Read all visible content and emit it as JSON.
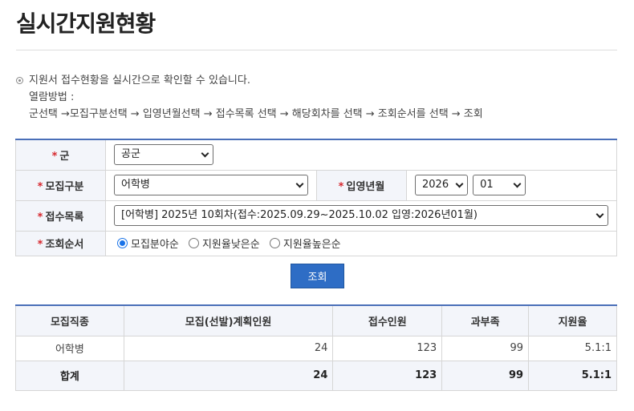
{
  "page": {
    "title": "실시간지원현황"
  },
  "notice": {
    "line1": "지원서 접수현황을 실시간으로 확인할 수 있습니다.",
    "line2": "열람방법 :",
    "line3": "군선택 →모집구분선택 → 입영년월선택 → 접수목록 선택 → 해당회차를 선택 → 조회순서를 선택 → 조회"
  },
  "form": {
    "required_mark": "*",
    "branch": {
      "label": "군",
      "value": "공군"
    },
    "recruit_type": {
      "label": "모집구분",
      "value": "어학병"
    },
    "enlist_month": {
      "label": "입영년월",
      "year": "2026",
      "month": "01"
    },
    "application_list": {
      "label": "접수목록",
      "value": "[어학병] 2025년 10회차(접수:2025.09.29~2025.10.02 입영:2026년01월)"
    },
    "sort_order": {
      "label": "조회순서",
      "options": [
        "모집분야순",
        "지원율낮은순",
        "지원율높은순"
      ],
      "selected": "모집분야순"
    }
  },
  "search_button": {
    "label": "조회"
  },
  "results": {
    "headers": [
      "모집직종",
      "모집(선발)계획인원",
      "접수인원",
      "과부족",
      "지원율"
    ],
    "rows": [
      {
        "category": "어학병",
        "planned": "24",
        "applied": "123",
        "surplus": "99",
        "ratio": "5.1:1"
      }
    ],
    "total": {
      "label": "합계",
      "planned": "24",
      "applied": "123",
      "surplus": "99",
      "ratio": "5.1:1"
    }
  },
  "colors": {
    "accent": "#2e6dc5",
    "required": "#d6262c",
    "header_bg": "#f3f5fa"
  }
}
